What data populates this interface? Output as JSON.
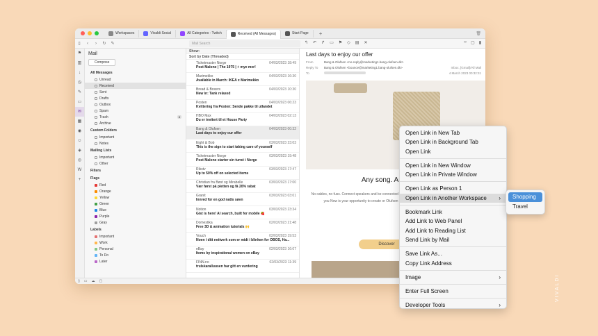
{
  "tabs": [
    {
      "label": "Workspaces",
      "color": "#888888"
    },
    {
      "label": "Vivaldi Social",
      "color": "#6364ff"
    },
    {
      "label": "All Categories - Twitch",
      "color": "#9146ff"
    },
    {
      "label": "Received (All Messages)",
      "color": "#555555"
    },
    {
      "label": "Start Page",
      "color": "#555555"
    }
  ],
  "toolbar": {
    "search_placeholder": "Mail Search"
  },
  "panel": {
    "title": "Mail",
    "compose": "Compose",
    "all_messages": "All Messages",
    "folders": [
      "Unread",
      "Received",
      "Sent",
      "Drafts",
      "Outbox",
      "Spam",
      "Trash",
      "Archive"
    ],
    "trash_count": "8",
    "custom_folders": "Custom Folders",
    "custom": [
      "Important",
      "Notes"
    ],
    "mailing_lists": "Mailing Lists",
    "lists": [
      "Important",
      "Other"
    ],
    "filters": "Filters",
    "flags_title": "Flags",
    "flags": [
      {
        "label": "Red",
        "color": "#e53935"
      },
      {
        "label": "Orange",
        "color": "#fb8c00"
      },
      {
        "label": "Yellow",
        "color": "#fdd835"
      },
      {
        "label": "Green",
        "color": "#43a047"
      },
      {
        "label": "Blue",
        "color": "#1e88e5"
      },
      {
        "label": "Purple",
        "color": "#8e24aa"
      },
      {
        "label": "Gray",
        "color": "#9e9e9e"
      }
    ],
    "labels_title": "Labels",
    "labels": [
      {
        "label": "Important",
        "color": "#e57373"
      },
      {
        "label": "Work",
        "color": "#ffb74d"
      },
      {
        "label": "Personal",
        "color": "#81c784"
      },
      {
        "label": "To Do",
        "color": "#64b5f6"
      },
      {
        "label": "Later",
        "color": "#ba68c8"
      }
    ]
  },
  "list": {
    "show": "Show:",
    "sort": "Sort by Date (Threaded)",
    "messages": [
      {
        "from": "Ticketmaster Norge",
        "date": "04/03/2023 18:49",
        "subject": "Post Malone | The 1975 | + mye mer!"
      },
      {
        "from": "Marimekko",
        "date": "04/03/2023 16:30",
        "subject": "Available in March: IKEA x Marimekko"
      },
      {
        "from": "Bread & Boxers",
        "date": "04/03/2023 10:30",
        "subject": "New in: Tank relaxed"
      },
      {
        "from": "Posten",
        "date": "04/03/2023 06:23",
        "subject": "Kvittering fra Posten: Sende pakke til utlandet"
      },
      {
        "from": "HBO Max",
        "date": "04/03/2023 02:13",
        "subject": "Du er invitert til et House Party"
      },
      {
        "from": "Bang & Olufsen",
        "date": "04/03/2023 00:32",
        "subject": "Last days to enjoy our offer"
      },
      {
        "from": "Eight & Bob",
        "date": "03/03/2023 23:03",
        "subject": "This is the sign to start taking care of yourself"
      },
      {
        "from": "Ticketmaster Norge",
        "date": "03/03/2023 19:48",
        "subject": "Post Malone starter sin turné i Norge"
      },
      {
        "from": "Rikstv",
        "date": "03/03/2023 17:47",
        "subject": "Up to 50% off on selected items"
      },
      {
        "from": "Christian fra Bøst og Mirabelle",
        "date": "03/03/2023 17:00",
        "subject": "Vær først på pletten og få 20% rabat"
      },
      {
        "from": "Granit",
        "date": "03/03/2023 03:01",
        "subject": "Innred for en god natts søvn"
      },
      {
        "from": "Notion",
        "date": "03/03/2023 23:34",
        "subject": "Gist is here! AI search, built for mobile 🍓"
      },
      {
        "from": "Domestika",
        "date": "02/03/2023 21:48",
        "subject": "Free 3D & animation tutorials 🙌"
      },
      {
        "from": "Vouch",
        "date": "02/03/2023 19:53",
        "subject": "Noen i ditt nettverk som er midt i blinken for OBOS, Ha..."
      },
      {
        "from": "eBay",
        "date": "02/03/2023 16:07",
        "subject": "Items by inspirational women on eBay"
      },
      {
        "from": "FINN.no",
        "date": "02/03/2023 11:39",
        "subject": "trulskaralluusen har gitt en vurdering"
      }
    ]
  },
  "reader": {
    "subject": "Last days to enjoy our offer",
    "from_label": "From",
    "from": "Bang & Olufsen <no-reply@marketing1.bang-olufsen.dk>",
    "reply_label": "Reply To",
    "reply": "Bang & Olufsen <bounce@marketing1.bang-olufsen.dk>",
    "to_label": "To",
    "folder": "Inbox, [Gmail]/All Mail",
    "date": "4 March 2023 00:32:31",
    "headline": "Any song. Any room.",
    "body": "No cables, no fuss. Connect speakers and be connected everywhere. Control palm of your hand; play what you Now is your opportunity to create or Olufsen home speaker system set up speakers on",
    "cta": "Discover"
  },
  "context_menu": [
    {
      "label": "Open Link in New Tab"
    },
    {
      "label": "Open Link in Background Tab"
    },
    {
      "label": "Open Link"
    },
    {
      "sep": true
    },
    {
      "label": "Open Link in New Window"
    },
    {
      "label": "Open Link in Private Window"
    },
    {
      "sep": true
    },
    {
      "label": "Open Link as Person 1"
    },
    {
      "label": "Open Link in Another Workspace",
      "submenu": true,
      "highlight": true
    },
    {
      "sep": true
    },
    {
      "label": "Bookmark Link"
    },
    {
      "label": "Add Link to Web Panel"
    },
    {
      "label": "Add Link to Reading List"
    },
    {
      "label": "Send Link by Mail"
    },
    {
      "sep": true
    },
    {
      "label": "Save Link As..."
    },
    {
      "label": "Copy Link Address"
    },
    {
      "sep": true
    },
    {
      "label": "Image",
      "submenu": true
    },
    {
      "sep": true
    },
    {
      "label": "Enter Full Screen"
    },
    {
      "sep": true
    },
    {
      "label": "Developer Tools",
      "submenu": true
    }
  ],
  "submenu": [
    {
      "label": "Shopping",
      "highlight": true
    },
    {
      "label": "Travel"
    }
  ],
  "brand": "VIVALDI"
}
